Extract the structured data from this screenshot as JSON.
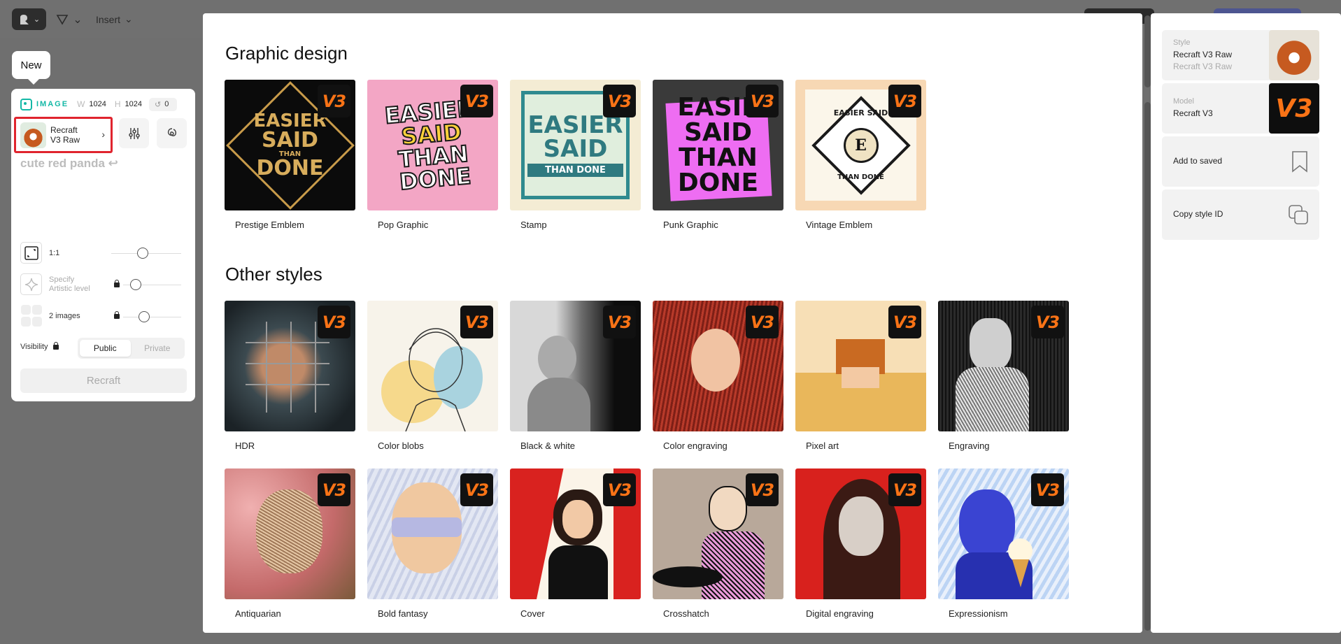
{
  "toolbar": {
    "insert_label": "Insert"
  },
  "new_label": "New",
  "left_panel": {
    "type_label": "IMAGE",
    "w_label": "W",
    "w_value": "1024",
    "h_label": "H",
    "h_value": "1024",
    "seed_value": "0",
    "model_line1": "Recraft",
    "model_line2": "V3 Raw",
    "prompt": "cute red panda ↩",
    "ratio_label": "1:1",
    "artistic_line1": "Specify",
    "artistic_line2": "Artistic level",
    "images_label": "2 images",
    "visibility_label": "Visibility",
    "public_label": "Public",
    "private_label": "Private",
    "recraft_label": "Recraft"
  },
  "gallery": {
    "section1_title": "Graphic design",
    "section1_items": [
      {
        "name": "Prestige Emblem",
        "badge": "V3"
      },
      {
        "name": "Pop Graphic",
        "badge": "V3"
      },
      {
        "name": "Stamp",
        "badge": "V3"
      },
      {
        "name": "Punk Graphic",
        "badge": "V3"
      },
      {
        "name": "Vintage Emblem",
        "badge": "V3"
      }
    ],
    "tile_texts": {
      "easier": "EASIER",
      "said": "SAID",
      "than": "THAN",
      "done": "DONE",
      "than_done": "THAN DONE",
      "easier_said": "EASIER SAID",
      "easie": "EASIE",
      "e": "E"
    },
    "section2_title": "Other styles",
    "section2_row1": [
      {
        "name": "HDR",
        "badge": "V3"
      },
      {
        "name": "Color blobs",
        "badge": "V3"
      },
      {
        "name": "Black & white",
        "badge": "V3"
      },
      {
        "name": "Color engraving",
        "badge": "V3"
      },
      {
        "name": "Pixel art",
        "badge": "V3"
      },
      {
        "name": "Engraving",
        "badge": "V3"
      }
    ],
    "section2_row2": [
      {
        "name": "Antiquarian",
        "badge": "V3"
      },
      {
        "name": "Bold fantasy",
        "badge": "V3"
      },
      {
        "name": "Cover",
        "badge": "V3"
      },
      {
        "name": "Crosshatch",
        "badge": "V3"
      },
      {
        "name": "Digital engraving",
        "badge": "V3"
      },
      {
        "name": "Expressionism",
        "badge": "V3"
      }
    ]
  },
  "right_panel": {
    "style_label": "Style",
    "style_value": "Recraft V3 Raw",
    "style_sub": "Recraft V3 Raw",
    "model_label": "Model",
    "model_value": "Recraft V3",
    "model_badge": "V3",
    "add_saved_label": "Add to saved",
    "copy_style_label": "Copy style ID"
  }
}
